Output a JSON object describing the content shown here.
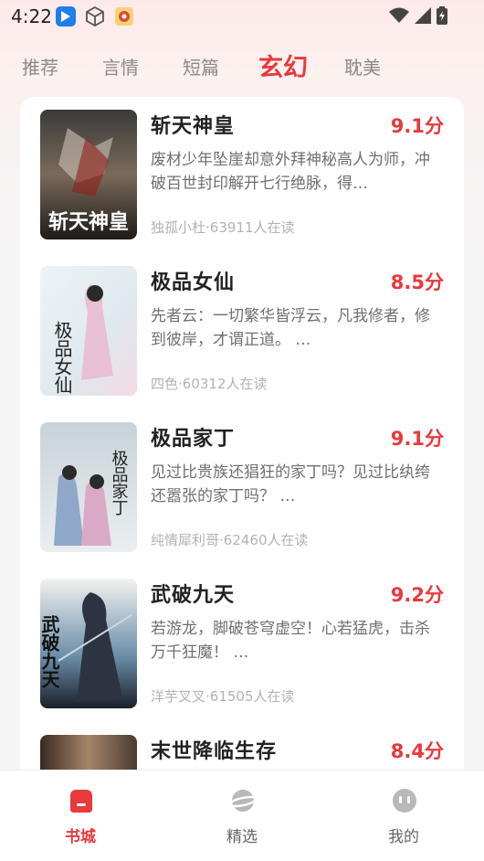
{
  "status_bar": {
    "time": "4:22"
  },
  "tabs": [
    {
      "label": "推荐",
      "active": false
    },
    {
      "label": "言情",
      "active": false
    },
    {
      "label": "短篇",
      "active": false
    },
    {
      "label": "玄幻",
      "active": true
    },
    {
      "label": "耽美",
      "active": false
    }
  ],
  "books": [
    {
      "title": "斩天神皇",
      "score": "9.1分",
      "description": "废材少年坠崖却意外拜神秘高人为师，冲破百世封印解开七行绝脉，得…",
      "author": "独孤小杜",
      "readers": "63911人在读",
      "cover_text": "斩天神皇"
    },
    {
      "title": "极品女仙",
      "score": "8.5分",
      "description": "先者云：一切繁华皆浮云，凡我修者，修到彼岸，才谓正道。 …",
      "author": "四色",
      "readers": "60312人在读",
      "cover_text": "极品女仙"
    },
    {
      "title": "极品家丁",
      "score": "9.1分",
      "description": "见过比贵族还猖狂的家丁吗？见过比纨绔还嚣张的家丁吗？ …",
      "author": "纯情犀利哥",
      "readers": "62460人在读",
      "cover_text": "极品家丁"
    },
    {
      "title": "武破九天",
      "score": "9.2分",
      "description": "若游龙，脚破苍穹虚空！心若猛虎，击杀万千狂魔！ …",
      "author": "洋芋叉叉",
      "readers": "61505人在读",
      "cover_text": "武破九天"
    },
    {
      "title": "末世降临生存",
      "score": "8.4分",
      "description": "",
      "author": "",
      "readers": "",
      "cover_text": ""
    }
  ],
  "bottom_nav": [
    {
      "label": "书城",
      "icon": "bookstore-icon",
      "active": true
    },
    {
      "label": "精选",
      "icon": "planet-icon",
      "active": false
    },
    {
      "label": "我的",
      "icon": "face-icon",
      "active": false
    }
  ],
  "colors": {
    "accent": "#e8393c",
    "muted": "#8a8a8a"
  }
}
